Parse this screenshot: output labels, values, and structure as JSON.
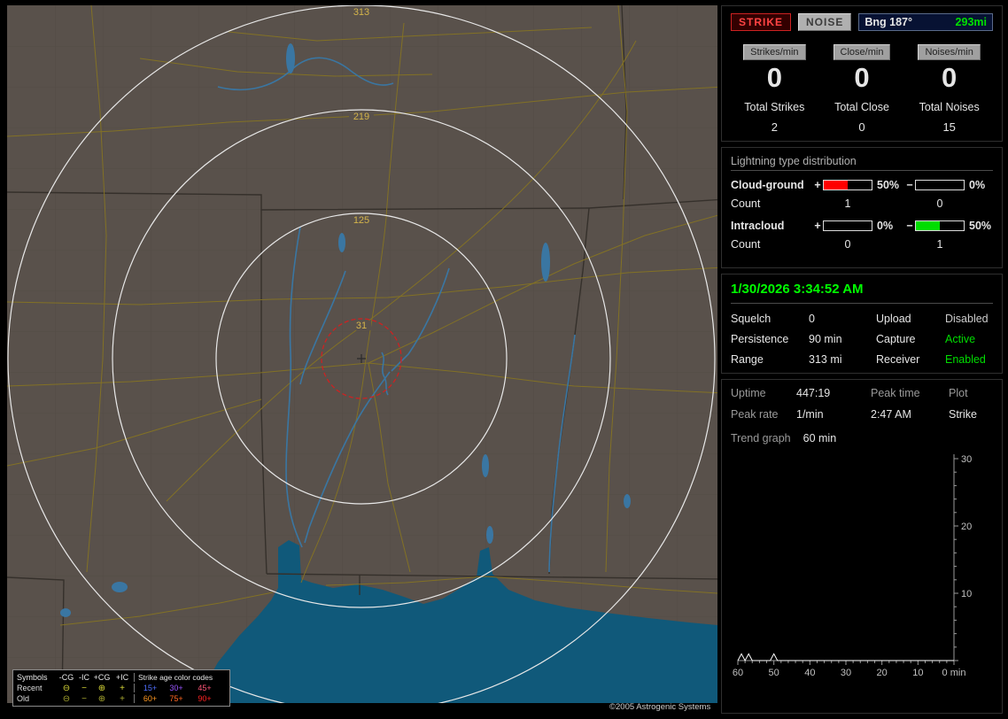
{
  "map": {
    "ring_labels": [
      "313",
      "219",
      "125",
      "31"
    ],
    "ring_label_color": "#d4b44a",
    "alarm_ring_color": "#cc2222",
    "copyright": "©2005 Astrogenic Systems",
    "legend": {
      "symbols_title": "Symbols",
      "columns": [
        "-CG",
        "-IC",
        "+CG",
        "+IC"
      ],
      "age_title": "Strike age color codes",
      "rows": [
        {
          "label": "Recent",
          "symbol_color": "#d8d838",
          "symbols": [
            "⊖",
            "−",
            "⊕",
            "+"
          ],
          "ages": [
            {
              "text": "15+",
              "color": "#4f6fff"
            },
            {
              "text": "30+",
              "color": "#9a55ff"
            },
            {
              "text": "45+",
              "color": "#ff5577"
            }
          ]
        },
        {
          "label": "Old",
          "symbol_color": "#a8a830",
          "symbols": [
            "⊖",
            "−",
            "⊕",
            "+"
          ],
          "ages": [
            {
              "text": "60+",
              "color": "#ff9922"
            },
            {
              "text": "75+",
              "color": "#ff6622"
            },
            {
              "text": "90+",
              "color": "#ff2222"
            }
          ]
        }
      ]
    }
  },
  "panel": {
    "strike_button": "STRIKE",
    "noise_button": "NOISE",
    "bearing_label": "Bng 187°",
    "bearing_range": "293mi",
    "rates": [
      {
        "label": "Strikes/min",
        "value": "0",
        "total_label": "Total Strikes",
        "total": "2"
      },
      {
        "label": "Close/min",
        "value": "0",
        "total_label": "Total Close",
        "total": "0"
      },
      {
        "label": "Noises/min",
        "value": "0",
        "total_label": "Total Noises",
        "total": "15"
      }
    ],
    "distribution": {
      "title": "Lightning type distribution",
      "pos_sign": "+",
      "neg_sign": "−",
      "rows": [
        {
          "label": "Cloud-ground",
          "pos": {
            "pct_text": "50%",
            "fill_pct": 50,
            "color": "#ff0000"
          },
          "neg": {
            "pct_text": "0%",
            "fill_pct": 0,
            "color": "#00cc00"
          },
          "count_label": "Count",
          "pos_count": "1",
          "neg_count": "0"
        },
        {
          "label": "Intracloud",
          "pos": {
            "pct_text": "0%",
            "fill_pct": 0,
            "color": "#ff0000"
          },
          "neg": {
            "pct_text": "50%",
            "fill_pct": 50,
            "color": "#00dd00"
          },
          "count_label": "Count",
          "pos_count": "0",
          "neg_count": "1"
        }
      ]
    },
    "clock": "1/30/2026 3:34:52 AM",
    "status_rows": [
      {
        "label": "Squelch",
        "value": "0",
        "label2": "Upload",
        "value2": "Disabled",
        "value2_color": "#cccccc"
      },
      {
        "label": "Persistence",
        "value": "90 min",
        "label2": "Capture",
        "value2": "Active",
        "value2_color": "#00dd00"
      },
      {
        "label": "Range",
        "value": "313 mi",
        "label2": "Receiver",
        "value2": "Enabled",
        "value2_color": "#00dd00"
      }
    ],
    "stats": {
      "uptime_label": "Uptime",
      "uptime": "447:19",
      "peak_time_label": "Peak time",
      "peak_time": "2:47 AM",
      "plot_label": "Plot",
      "plot": "Strike",
      "peak_rate_label": "Peak rate",
      "peak_rate": "1/min",
      "trend_label": "Trend graph",
      "trend_window": "60 min"
    }
  },
  "chart_data": {
    "type": "line",
    "title": "Trend graph",
    "xlabel": "min",
    "x_ticks": [
      60,
      50,
      40,
      30,
      20,
      10,
      0
    ],
    "x_axis_end_label": "0 min",
    "y_ticks": [
      10,
      20,
      30
    ],
    "ylim": [
      0,
      30
    ],
    "window_minutes": 60,
    "series": [
      {
        "name": "Strike",
        "values_by_min_ago": {
          "59": 1,
          "57": 1,
          "50": 1
        }
      }
    ]
  }
}
